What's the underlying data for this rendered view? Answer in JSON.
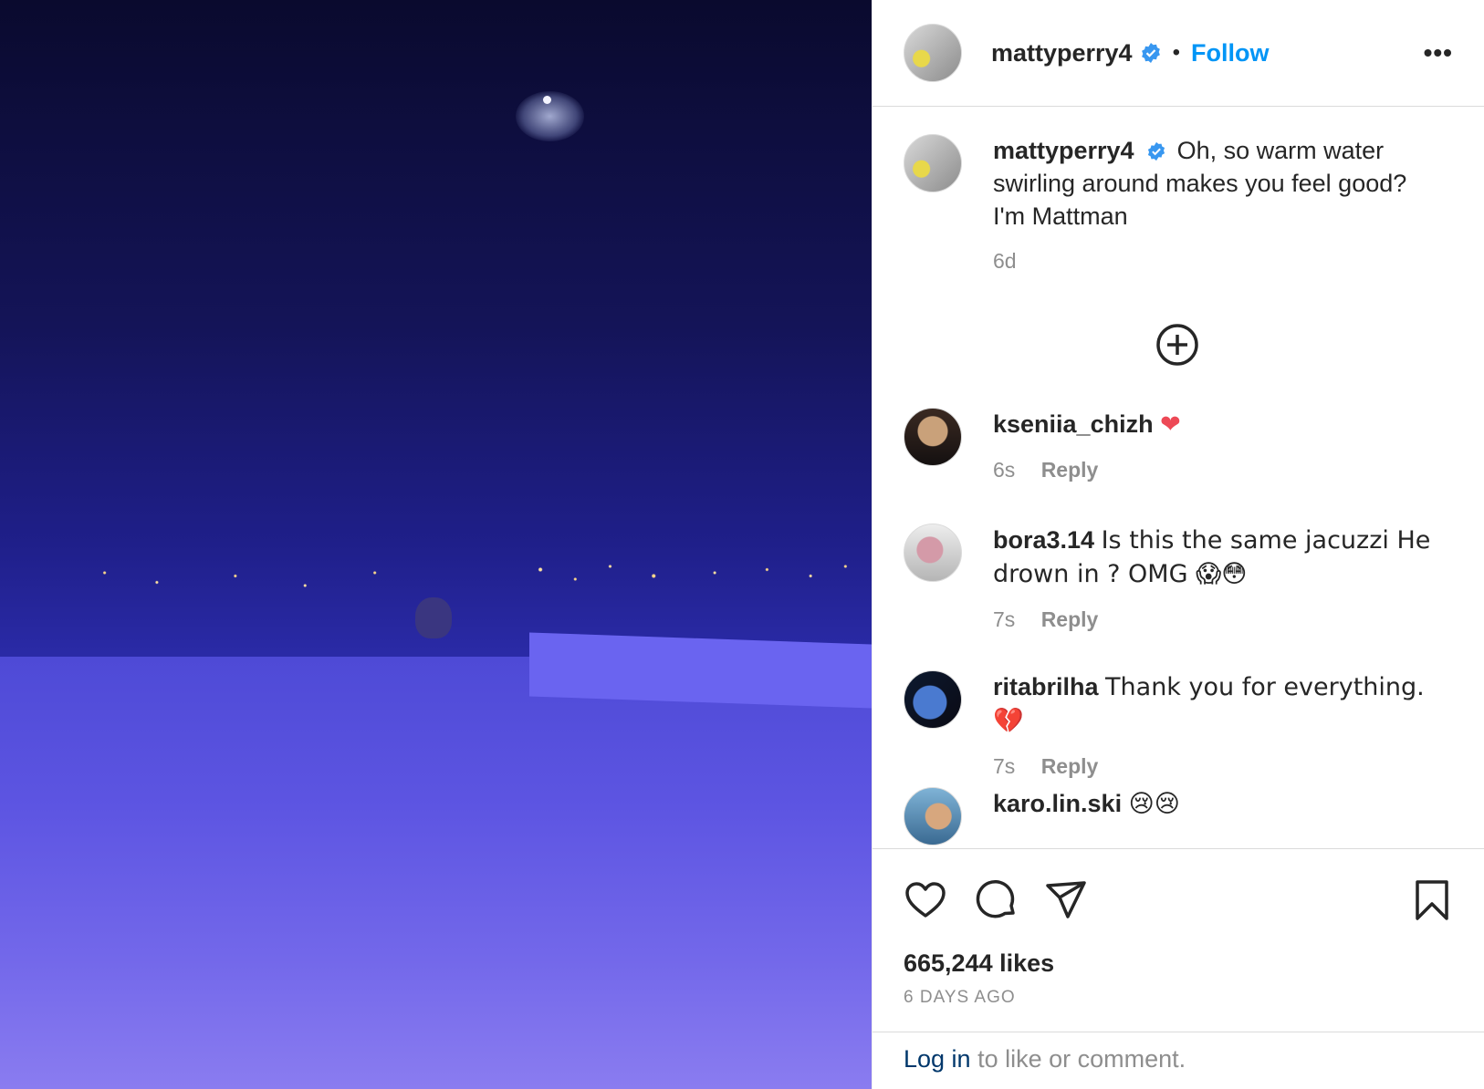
{
  "header": {
    "username": "mattyperry4",
    "separator": "•",
    "follow_label": "Follow",
    "more_label": "•••"
  },
  "caption": {
    "username": "mattyperry4",
    "text": "Oh, so warm water swirling around makes you feel good? I'm Mattman",
    "time": "6d"
  },
  "comments": [
    {
      "username": "kseniia_chizh",
      "text": "❤",
      "time": "6s",
      "reply": "Reply"
    },
    {
      "username": "bora3.14",
      "text": "Is this the same jacuzzi He drown in ? OMG 😱😳",
      "time": "7s",
      "reply": "Reply"
    },
    {
      "username": "ritabrilha",
      "text": "Thank you for everything. 💔",
      "time": "7s",
      "reply": "Reply"
    },
    {
      "username": "karo.lin.ski",
      "text": "😢😢",
      "time": "",
      "reply": ""
    }
  ],
  "actions": {
    "likes": "665,244 likes",
    "date": "6 DAYS AGO"
  },
  "login": {
    "link": "Log in",
    "text": " to like or comment."
  },
  "colors": {
    "accent": "#0095f6",
    "verified": "#3897f0",
    "text": "#262626",
    "muted": "#8e8e8e"
  }
}
